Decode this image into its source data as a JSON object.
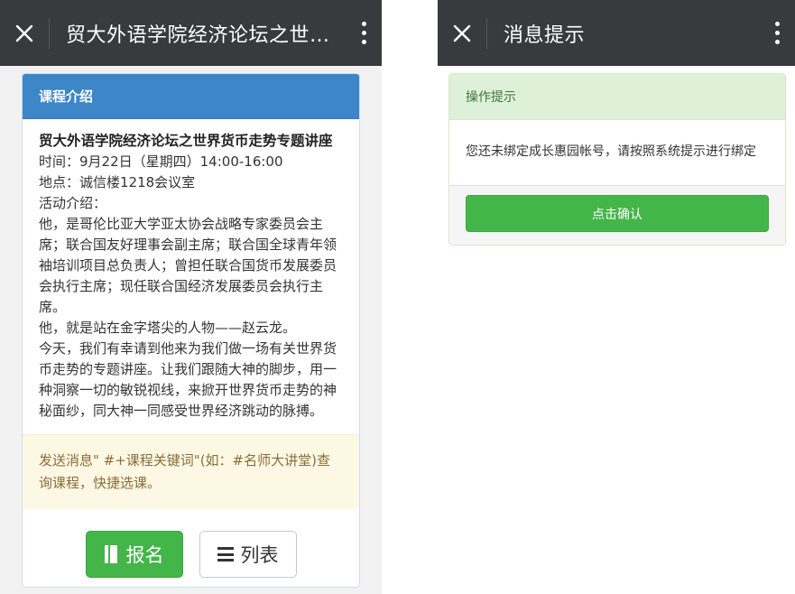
{
  "left": {
    "title": "贸大外语学院经济论坛之世界货币走势专题讲座",
    "card_header": "课程介绍",
    "course_title": "贸大外语学院经济论坛之世界货币走势专题讲座",
    "time": "时间：9月22日（星期四）14:00-16:00",
    "place": "地点：诚信楼1218会议室",
    "intro_label": "活动介绍：",
    "intro_p1": "他，是哥伦比亚大学亚太协会战略专家委员会主席；联合国友好理事会副主席；联合国全球青年领袖培训项目总负责人；曾担任联合国货币发展委员会执行主席；现任联合国经济发展委员会执行主席。",
    "intro_p2": "他，就是站在金字塔尖的人物——赵云龙。",
    "intro_p3": "今天，我们有幸请到他来为我们做一场有关世界货币走势的专题讲座。让我们跟随大神的脚步，用一种洞察一切的敏锐视线，来掀开世界货币走势的神秘面纱，同大神一同感受世界经济跳动的脉搏。",
    "notice": "发送消息\" #+课程关键词\"(如：#名师大讲堂)查询课程，快捷选课。",
    "enroll_label": "报名",
    "list_label": "列表"
  },
  "right": {
    "title": "消息提示",
    "panel_header": "操作提示",
    "message": "您还未绑定成长惠园帐号，请按照系统提示进行绑定",
    "confirm_label": "点击确认"
  }
}
